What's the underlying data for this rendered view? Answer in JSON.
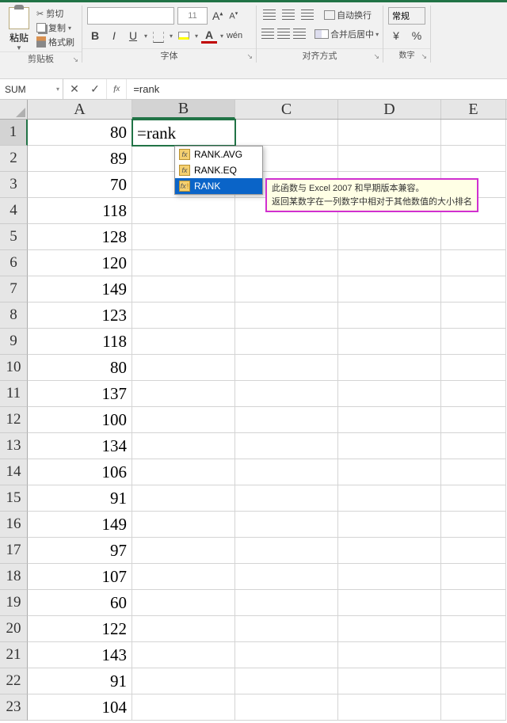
{
  "ribbon": {
    "clipboard": {
      "paste": "粘贴",
      "cut": "剪切",
      "copy": "复制",
      "format_painter": "格式刷",
      "group_label": "剪贴板"
    },
    "font": {
      "name_placeholder": "",
      "size": "11",
      "group_label": "字体"
    },
    "alignment": {
      "wrap_text": "自动换行",
      "merge_center": "合并后居中",
      "group_label": "对齐方式"
    },
    "number": {
      "format": "常规",
      "group_label": "数字"
    }
  },
  "name_box": "SUM",
  "formula_bar": "=rank",
  "columns": [
    "A",
    "B",
    "C",
    "D",
    "E"
  ],
  "rows": [
    {
      "n": 1,
      "A": "80",
      "B": "=rank"
    },
    {
      "n": 2,
      "A": "89"
    },
    {
      "n": 3,
      "A": "70"
    },
    {
      "n": 4,
      "A": "118"
    },
    {
      "n": 5,
      "A": "128"
    },
    {
      "n": 6,
      "A": "120"
    },
    {
      "n": 7,
      "A": "149"
    },
    {
      "n": 8,
      "A": "123"
    },
    {
      "n": 9,
      "A": "118"
    },
    {
      "n": 10,
      "A": "80"
    },
    {
      "n": 11,
      "A": "137"
    },
    {
      "n": 12,
      "A": "100"
    },
    {
      "n": 13,
      "A": "134"
    },
    {
      "n": 14,
      "A": "106"
    },
    {
      "n": 15,
      "A": "91"
    },
    {
      "n": 16,
      "A": "149"
    },
    {
      "n": 17,
      "A": "97"
    },
    {
      "n": 18,
      "A": "107"
    },
    {
      "n": 19,
      "A": "60"
    },
    {
      "n": 20,
      "A": "122"
    },
    {
      "n": 21,
      "A": "143"
    },
    {
      "n": 22,
      "A": "91"
    },
    {
      "n": 23,
      "A": "104"
    }
  ],
  "autocomplete": {
    "items": [
      {
        "label": "RANK.AVG",
        "warn": false
      },
      {
        "label": "RANK.EQ",
        "warn": false
      },
      {
        "label": "RANK",
        "warn": true,
        "selected": true
      }
    ]
  },
  "tooltip": {
    "line1": "此函数与 Excel 2007 和早期版本兼容。",
    "line2": "返回某数字在一列数字中相对于其他数值的大小排名"
  }
}
